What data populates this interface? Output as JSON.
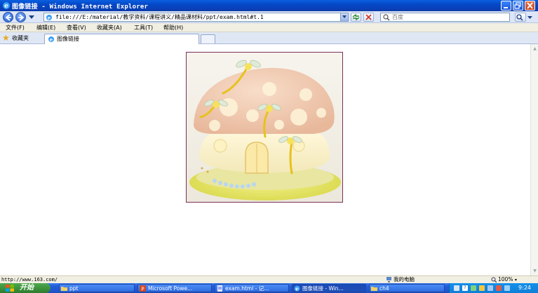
{
  "window": {
    "title": "图像链接 - Windows Internet Explorer",
    "buttons": {
      "minimize": "_",
      "maximize": "□",
      "close": "×"
    }
  },
  "address": {
    "url": "file:///E:/material/教学资料/课程讲义/精品课材料/ppt/exam.html#t.1",
    "search_placeholder": "百度"
  },
  "menu": [
    "文件(F)",
    "编辑(E)",
    "查看(V)",
    "收藏夹(A)",
    "工具(T)",
    "帮助(H)"
  ],
  "favorites": {
    "label": "收藏夹"
  },
  "tabs": [
    {
      "label": "图像链接",
      "active": true
    }
  ],
  "content": {
    "image": {
      "description_icon": "mushroom-cake-image"
    }
  },
  "status": {
    "text": "http://www.163.com/",
    "zone": "我的电脑",
    "zoom": "100%"
  },
  "taskbar": {
    "start_label": "开始",
    "items": [
      {
        "label": "ppt",
        "icon": "folder-icon"
      },
      {
        "label": "Microsoft Powe...",
        "icon": "powerpoint-icon"
      },
      {
        "label": "exam.html - 记...",
        "icon": "notepad-icon"
      },
      {
        "label": "图像链接 - Win...",
        "icon": "ie-icon",
        "active": true
      },
      {
        "label": "ch4",
        "icon": "folder-icon"
      }
    ],
    "clock": "9:24"
  },
  "colors": {
    "title_blue": "#0548c7",
    "taskbar_blue": "#245edb",
    "start_green": "#3a8f3a",
    "image_border": "#7a2f57"
  }
}
